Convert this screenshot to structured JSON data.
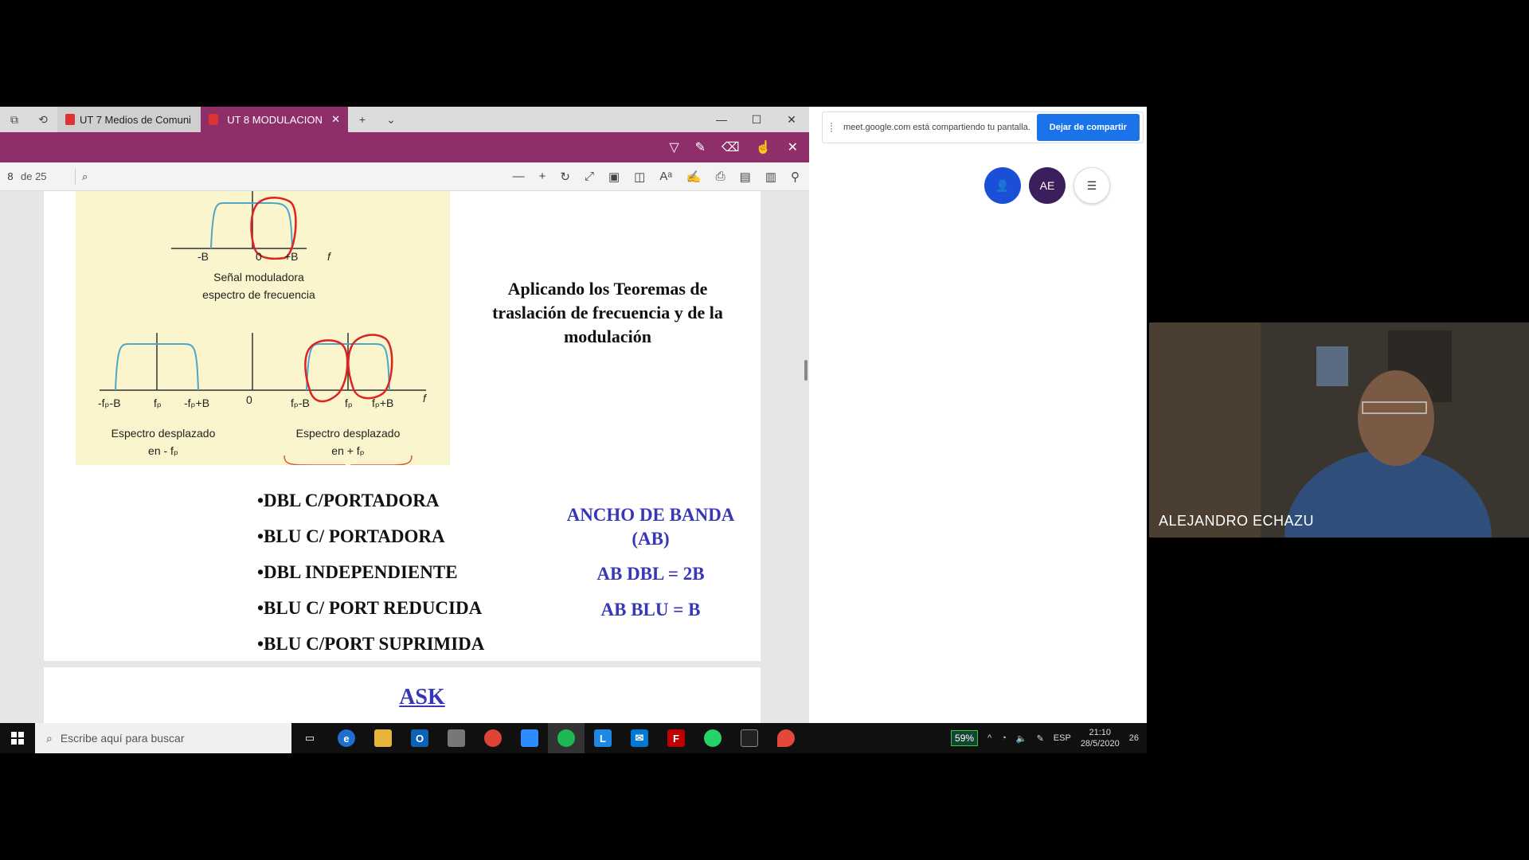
{
  "browser": {
    "tabs": [
      {
        "label": "UT 7 Medios de Comuni",
        "active": false
      },
      {
        "label": "UT 8 MODULACION",
        "active": true
      }
    ],
    "pdf_toolbar": {
      "page": "8",
      "page_total": "de 25"
    }
  },
  "diagram": {
    "top_ticks": [
      "-B",
      "0",
      "+B",
      "f"
    ],
    "top_caption_line1": "Señal moduladora",
    "top_caption_line2": "espectro de frecuencia",
    "bottom_ticks": [
      "-fₚ-B",
      "fₚ",
      "-fₚ+B",
      "0",
      "fₚ-B",
      "fₚ",
      "fₚ+B",
      "f"
    ],
    "left_caption_line1": "Espectro desplazado",
    "left_caption_line2": "en - fₚ",
    "right_caption_line1": "Espectro desplazado",
    "right_caption_line2": "en + fₚ"
  },
  "slide": {
    "heading": "Aplicando los Teoremas de traslación de frecuencia y de la modulación",
    "bullets": [
      "•DBL C/PORTADORA",
      "•BLU C/ PORTADORA",
      "•DBL INDEPENDIENTE",
      "•BLU C/ PORT REDUCIDA",
      "•BLU C/PORT SUPRIMIDA"
    ],
    "bandwidth_title": "ANCHO DE BANDA (AB)",
    "ab_dbl": "AB DBL = 2B",
    "ab_blu": "AB BLU =  B",
    "next_page_title": "ASK"
  },
  "meet": {
    "share_notice": "meet.google.com está compartiendo tu pantalla.",
    "stop_share_label": "Dejar de compartir",
    "avatar_initials": "AE",
    "participant_name": "ALEJANDRO ECHAZU"
  },
  "taskbar": {
    "search_placeholder": "Escribe aquí para buscar",
    "battery": "59%",
    "language": "ESP",
    "time": "21:10",
    "date": "28/5/2020",
    "notifications": "26"
  },
  "colors": {
    "pdf_accent": "#8e2f6a",
    "meet_blue": "#1a73e8",
    "slide_blue": "#3737b8",
    "diagram_bg": "#fbf5cd"
  }
}
